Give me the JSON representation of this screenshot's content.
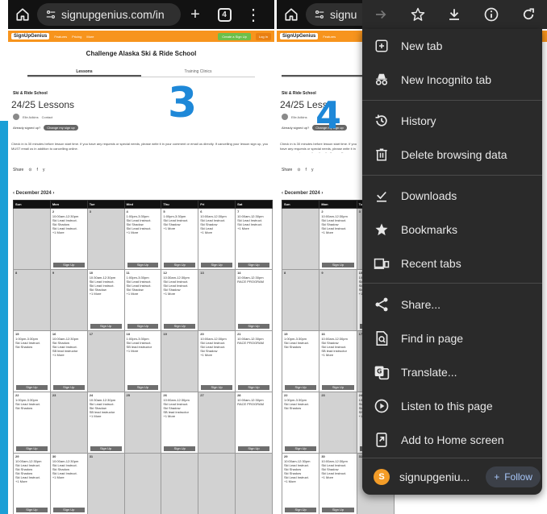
{
  "browser": {
    "left_url": "signupgenius.com/in",
    "right_url": "signu",
    "tab_count": "4"
  },
  "site": {
    "logo": "SignUpGenius",
    "nav": [
      "Features",
      "Pricing",
      "More"
    ],
    "create_label": "Create a Sign Up",
    "login_label": "Log In"
  },
  "page": {
    "title": "Challenge Alaska Ski & Ride School",
    "tabs": [
      "Lessons",
      "Training Clinics"
    ],
    "org": "Ski & Ride School",
    "lesson_count": "24/25 Lessons",
    "right_lesson_count": "24/25 Less",
    "creator": "Elle Adkins",
    "contact": "Contact",
    "signed_up_q": "Already signed up?",
    "signed_up_btn": "Change my sign up",
    "note": "Check in is 30 minutes before lesson start time. If you have any requests or special needs, please write it in your comment or email us directly. If cancelling your lesson sign up, you MUST email us in addition to cancelling online.",
    "share": "Share"
  },
  "annotations": {
    "left": "3",
    "right": "4"
  },
  "calendar": {
    "month": "December 2024",
    "days": [
      "Sun",
      "Mon",
      "Tue",
      "Wed",
      "Thu",
      "Fri",
      "Sat"
    ],
    "signup_label": "Sign Up",
    "weeks": [
      [
        {
          "d": "",
          "t": ""
        },
        {
          "d": "2",
          "t": "10:00am-12:30pm\nSki Lead Instruct.\nSki Shadow\nSki Lead Instruct.\n+1 More"
        },
        {
          "d": "3",
          "t": ""
        },
        {
          "d": "4",
          "t": "1:00pm-3:30pm\nSki Lead Instruct.\nSki Shadow\nSki Lead Instruct.\n+1 More"
        },
        {
          "d": "5",
          "t": "1:00pm-3:30pm\nSki Lead Instruct.\nSki Shadow\n+1 More"
        },
        {
          "d": "6",
          "t": "10:00am-12:30pm\nSki Lead Instruct.\nSki Shadow\nSki Lead\n+1 More"
        },
        {
          "d": "7",
          "t": "10:00am-12:30pm\nSki Lead Instruct.\nSki Lead Instruct.\n+1 More"
        }
      ],
      [
        {
          "d": "8",
          "t": ""
        },
        {
          "d": "9",
          "t": ""
        },
        {
          "d": "10",
          "t": "10:30am-12:30pm\nSki Lead Instruct.\nSki Lead Instruct.\nSki Shadow\n+1 More"
        },
        {
          "d": "11",
          "t": "1:00pm-3:30pm\nSki Lead Instruct.\nSki Lead Instruct.\nSki Shadow\n+1 More"
        },
        {
          "d": "12",
          "t": "10:30am-12:30pm\nSki Lead Instruct.\nSki Lead Instruct.\nSki Shadow\n+1 More"
        },
        {
          "d": "13",
          "t": ""
        },
        {
          "d": "14",
          "t": "10:00am-12:30pm\nRACE PROGRAM"
        }
      ],
      [
        {
          "d": "15",
          "t": "1:00pm-3:30pm\nSki Lead Instruct.\nSki Shadow"
        },
        {
          "d": "16",
          "t": "10:00am-12:30pm\nSki Shadow\nSki Lead Instruct.\nSB lead instructor\n+1 More"
        },
        {
          "d": "17",
          "t": ""
        },
        {
          "d": "18",
          "t": "1:00pm-3:30pm\nSki Lead Instruct.\nSB lead instructor\n+1 More"
        },
        {
          "d": "19",
          "t": ""
        },
        {
          "d": "20",
          "t": "10:00am-12:30pm\nSki Lead Instruct.\nSki Lead Instruct.\nSki Shadow\n+1 More"
        },
        {
          "d": "21",
          "t": "10:00am-12:30pm\nRACE PROGRAM"
        }
      ],
      [
        {
          "d": "22",
          "t": "1:00pm-3:30pm\nSki Lead Instruct.\nSki Shadow"
        },
        {
          "d": "23",
          "t": ""
        },
        {
          "d": "24",
          "t": "10:30am-12:30pm\nSki Lead Instruct.\nSki Shadow\nSB lead instructor\n+1 More"
        },
        {
          "d": "25",
          "t": ""
        },
        {
          "d": "26",
          "t": "10:00am-12:30pm\nSki Lead Instruct.\nSki Shadow\nSB lead instructor\n+1 More"
        },
        {
          "d": "27",
          "t": ""
        },
        {
          "d": "28",
          "t": "10:00am-12:30pm\nRACE PROGRAM"
        }
      ],
      [
        {
          "d": "29",
          "t": "10:00am-12:30pm\nSki Lead Instruct.\nSki Shadow\nSki Shadow\nSki Lead Instruct.\n+1 More"
        },
        {
          "d": "30",
          "t": "10:00am-12:30pm\nSki Lead Instruct.\nSki Shadow\nSki Lead Instruct.\n+1 More"
        },
        {
          "d": "31",
          "t": ""
        },
        {
          "d": "",
          "t": ""
        },
        {
          "d": "",
          "t": ""
        },
        {
          "d": "",
          "t": ""
        },
        {
          "d": "",
          "t": ""
        }
      ]
    ]
  },
  "menu": {
    "items": [
      {
        "label": "New tab",
        "icon": "new-tab-icon"
      },
      {
        "label": "New Incognito tab",
        "icon": "incognito-icon"
      },
      {
        "label": "History",
        "icon": "history-icon"
      },
      {
        "label": "Delete browsing data",
        "icon": "trash-icon"
      },
      {
        "label": "Downloads",
        "icon": "downloads-icon"
      },
      {
        "label": "Bookmarks",
        "icon": "star-icon"
      },
      {
        "label": "Recent tabs",
        "icon": "recent-tabs-icon"
      },
      {
        "label": "Share...",
        "icon": "share-icon"
      },
      {
        "label": "Find in page",
        "icon": "find-icon"
      },
      {
        "label": "Translate...",
        "icon": "translate-icon"
      },
      {
        "label": "Listen to this page",
        "icon": "play-icon"
      },
      {
        "label": "Add to Home screen",
        "icon": "add-home-icon"
      }
    ],
    "site_initial": "S",
    "site_name": "signupgeniu...",
    "follow_label": "Follow"
  }
}
